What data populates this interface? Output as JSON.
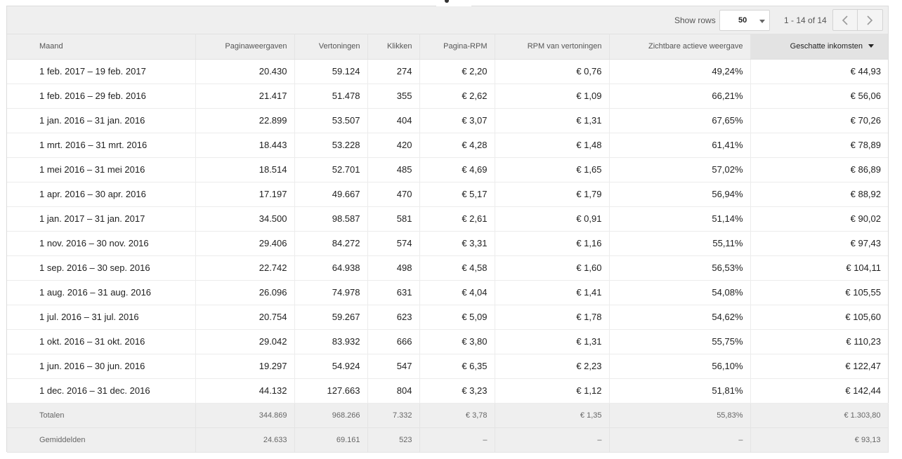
{
  "toolbar": {
    "show_rows_label": "Show rows",
    "rows_per_page": "50",
    "page_range": "1 - 14 of 14"
  },
  "table": {
    "columns": [
      "Maand",
      "Paginaweergaven",
      "Vertoningen",
      "Klikken",
      "Pagina-RPM",
      "RPM van vertoningen",
      "Zichtbare actieve weergave",
      "Geschatte inkomsten"
    ],
    "sorted_column": "Geschatte inkomsten",
    "sort_direction": "descending",
    "rows": [
      [
        "1 feb. 2017 – 19 feb. 2017",
        "20.430",
        "59.124",
        "274",
        "€ 2,20",
        "€ 0,76",
        "49,24%",
        "€ 44,93"
      ],
      [
        "1 feb. 2016 – 29 feb. 2016",
        "21.417",
        "51.478",
        "355",
        "€ 2,62",
        "€ 1,09",
        "66,21%",
        "€ 56,06"
      ],
      [
        "1 jan. 2016 – 31 jan. 2016",
        "22.899",
        "53.507",
        "404",
        "€ 3,07",
        "€ 1,31",
        "67,65%",
        "€ 70,26"
      ],
      [
        "1 mrt. 2016 – 31 mrt. 2016",
        "18.443",
        "53.228",
        "420",
        "€ 4,28",
        "€ 1,48",
        "61,41%",
        "€ 78,89"
      ],
      [
        "1 mei 2016 – 31 mei 2016",
        "18.514",
        "52.701",
        "485",
        "€ 4,69",
        "€ 1,65",
        "57,02%",
        "€ 86,89"
      ],
      [
        "1 apr. 2016 – 30 apr. 2016",
        "17.197",
        "49.667",
        "470",
        "€ 5,17",
        "€ 1,79",
        "56,94%",
        "€ 88,92"
      ],
      [
        "1 jan. 2017 – 31 jan. 2017",
        "34.500",
        "98.587",
        "581",
        "€ 2,61",
        "€ 0,91",
        "51,14%",
        "€ 90,02"
      ],
      [
        "1 nov. 2016 – 30 nov. 2016",
        "29.406",
        "84.272",
        "574",
        "€ 3,31",
        "€ 1,16",
        "55,11%",
        "€ 97,43"
      ],
      [
        "1 sep. 2016 – 30 sep. 2016",
        "22.742",
        "64.938",
        "498",
        "€ 4,58",
        "€ 1,60",
        "56,53%",
        "€ 104,11"
      ],
      [
        "1 aug. 2016 – 31 aug. 2016",
        "26.096",
        "74.978",
        "631",
        "€ 4,04",
        "€ 1,41",
        "54,08%",
        "€ 105,55"
      ],
      [
        "1 jul. 2016 – 31 jul. 2016",
        "20.754",
        "59.267",
        "623",
        "€ 5,09",
        "€ 1,78",
        "54,62%",
        "€ 105,60"
      ],
      [
        "1 okt. 2016 – 31 okt. 2016",
        "29.042",
        "83.932",
        "666",
        "€ 3,80",
        "€ 1,31",
        "55,75%",
        "€ 110,23"
      ],
      [
        "1 jun. 2016 – 30 jun. 2016",
        "19.297",
        "54.924",
        "547",
        "€ 6,35",
        "€ 2,23",
        "56,10%",
        "€ 122,47"
      ],
      [
        "1 dec. 2016 – 31 dec. 2016",
        "44.132",
        "127.663",
        "804",
        "€ 3,23",
        "€ 1,12",
        "51,81%",
        "€ 142,44"
      ]
    ],
    "totals": [
      "Totalen",
      "344.869",
      "968.266",
      "7.332",
      "€ 3,78",
      "€ 1,35",
      "55,83%",
      "€ 1.303,80"
    ],
    "averages": [
      "Gemiddelden",
      "24.633",
      "69.161",
      "523",
      "–",
      "–",
      "–",
      "€ 93,13"
    ]
  },
  "icons": {
    "prev": "chevron-left-icon",
    "next": "chevron-right-icon",
    "sort": "sort-descending-caret-icon",
    "select": "dropdown-caret-icon"
  },
  "colors": {
    "header_bg": "#efefef",
    "sorted_header_bg": "#e3e3e3",
    "text": "#212121",
    "muted_text": "#666666"
  }
}
